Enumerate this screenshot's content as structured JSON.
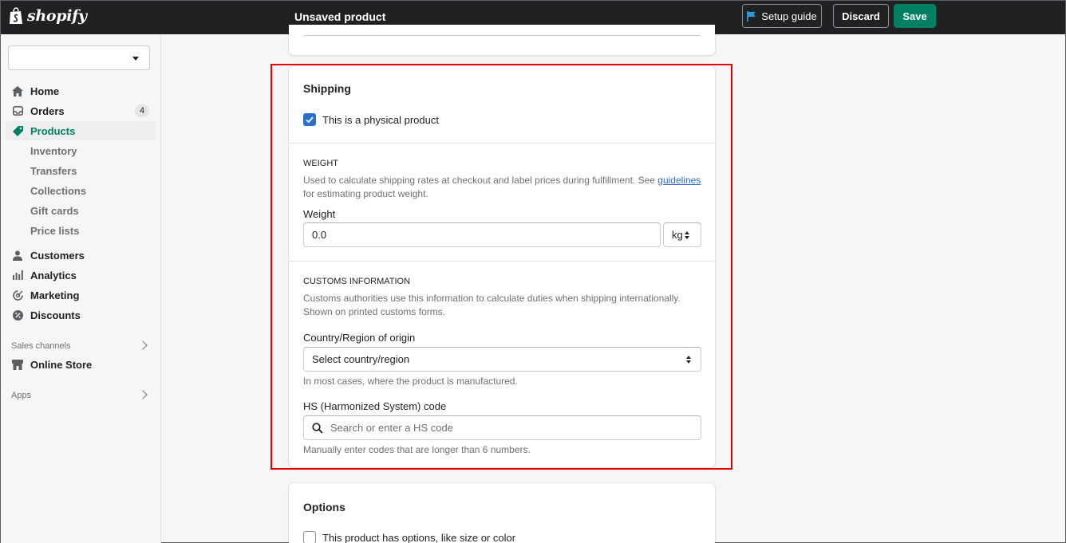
{
  "topbar": {
    "logo_text": "shopify",
    "page_title": "Unsaved product",
    "setup_guide_label": "Setup guide",
    "discard_label": "Discard",
    "save_label": "Save"
  },
  "sidebar": {
    "store_select_value": "",
    "nav": {
      "home": "Home",
      "orders": "Orders",
      "orders_count": "4",
      "products": "Products",
      "inventory": "Inventory",
      "transfers": "Transfers",
      "collections": "Collections",
      "gift_cards": "Gift cards",
      "price_lists": "Price lists",
      "customers": "Customers",
      "analytics": "Analytics",
      "marketing": "Marketing",
      "discounts": "Discounts"
    },
    "sales_channels_label": "Sales channels",
    "online_store": "Online Store",
    "apps_label": "Apps"
  },
  "shipping": {
    "title": "Shipping",
    "physical_product_label": "This is a physical product",
    "physical_product_checked": true,
    "weight_heading": "WEIGHT",
    "weight_help_prefix": "Used to calculate shipping rates at checkout and label prices during fulfillment. See ",
    "weight_help_link": "guidelines",
    "weight_help_suffix": "for estimating product weight.",
    "weight_label": "Weight",
    "weight_value": "0.0",
    "weight_unit": "kg",
    "customs_heading": "CUSTOMS INFORMATION",
    "customs_help": "Customs authorities use this information to calculate duties when shipping internationally. Shown on printed customs forms.",
    "country_label": "Country/Region of origin",
    "country_value": "Select country/region",
    "country_help": "In most cases, where the product is manufactured.",
    "hs_label": "HS (Harmonized System) code",
    "hs_placeholder": "Search or enter a HS code",
    "hs_help": "Manually enter codes that are longer than 6 numbers."
  },
  "options": {
    "title": "Options",
    "has_options_label": "This product has options, like size or color",
    "has_options_checked": false
  },
  "colors": {
    "accent_green": "#008060",
    "highlight_red": "#e80000",
    "link_blue": "#2c6ecb"
  }
}
